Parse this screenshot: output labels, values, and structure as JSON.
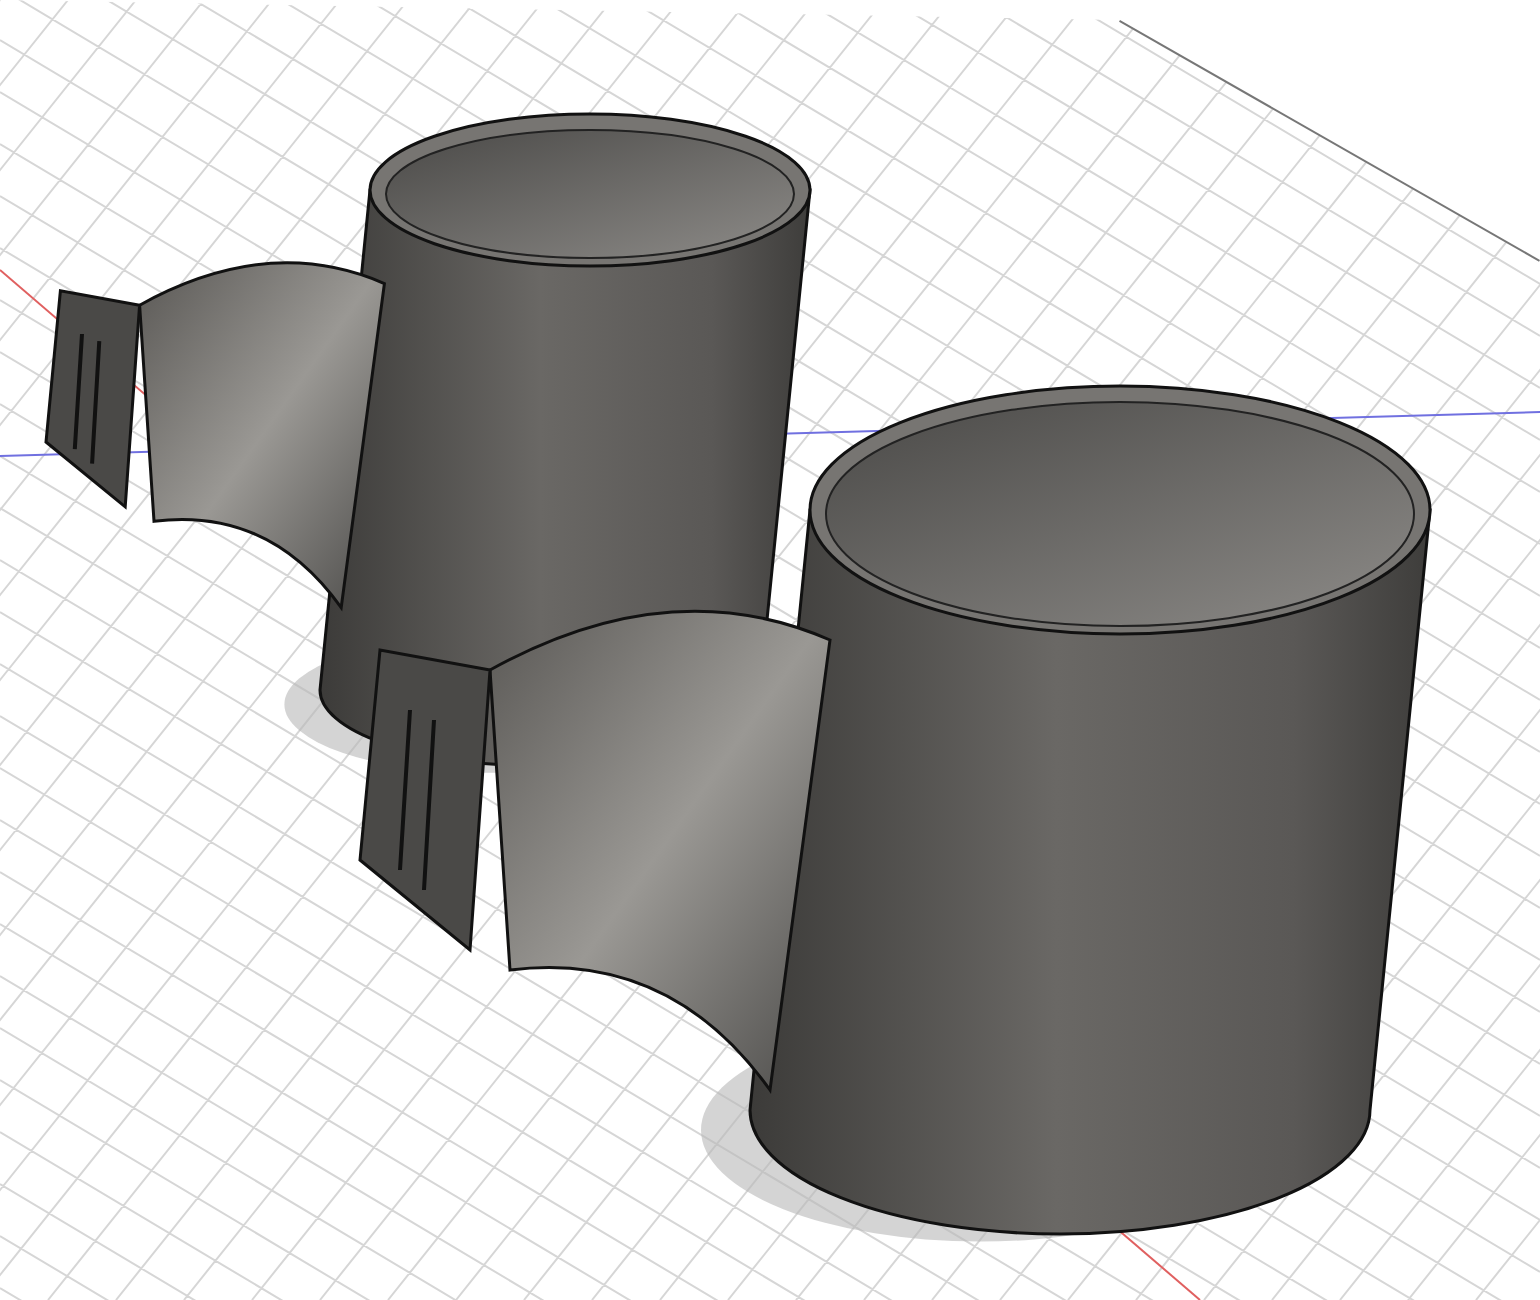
{
  "viewport": {
    "show_grid": true,
    "show_axes": true
  },
  "bodies": [
    {
      "kind": "adapter"
    },
    {
      "kind": "adapter"
    }
  ]
}
